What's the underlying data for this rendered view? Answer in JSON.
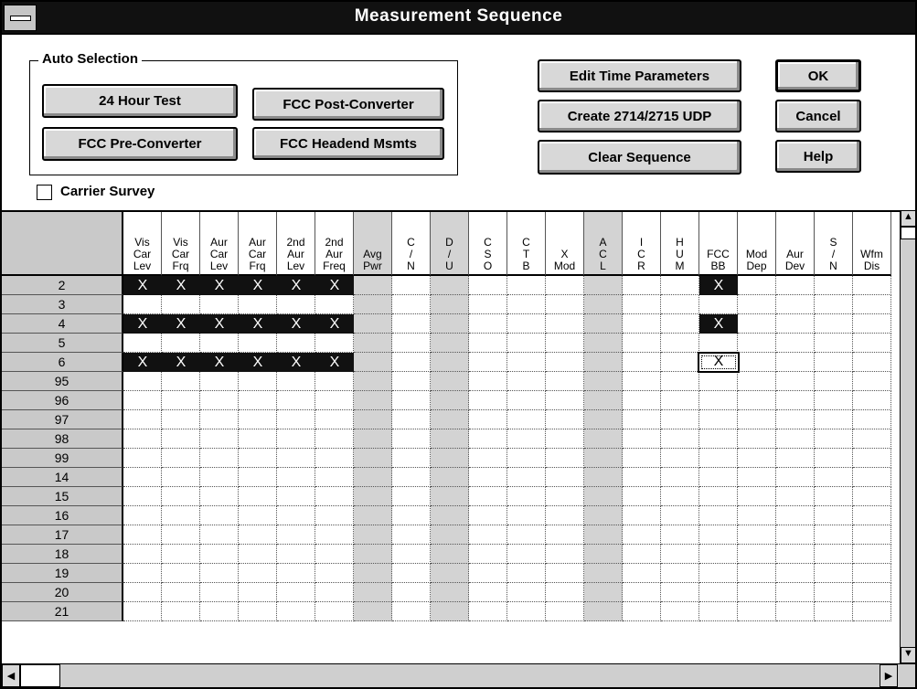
{
  "window": {
    "title": "Measurement Sequence"
  },
  "auto_selection": {
    "label": "Auto Selection",
    "buttons": [
      "24 Hour Test",
      "FCC Post-Converter",
      "FCC Pre-Converter",
      "FCC Headend Msmts"
    ]
  },
  "actions": {
    "edit_time": "Edit Time Parameters",
    "create_udp": "Create 2714/2715 UDP",
    "clear": "Clear Sequence",
    "ok": "OK",
    "cancel": "Cancel",
    "help": "Help"
  },
  "carrier_survey": {
    "label": "Carrier Survey",
    "checked": false
  },
  "columns": [
    {
      "label": "Vis\nCar\nLev",
      "shaded": false
    },
    {
      "label": "Vis\nCar\nFrq",
      "shaded": false
    },
    {
      "label": "Aur\nCar\nLev",
      "shaded": false
    },
    {
      "label": "Aur\nCar\nFrq",
      "shaded": false
    },
    {
      "label": "2nd\nAur\nLev",
      "shaded": false
    },
    {
      "label": "2nd\nAur\nFreq",
      "shaded": false
    },
    {
      "label": "Avg\nPwr",
      "shaded": true
    },
    {
      "label": "C\n/\nN",
      "shaded": false
    },
    {
      "label": "D\n/\nU",
      "shaded": true
    },
    {
      "label": "C\nS\nO",
      "shaded": false
    },
    {
      "label": "C\nT\nB",
      "shaded": false
    },
    {
      "label": "X\nMod",
      "shaded": false
    },
    {
      "label": "A\nC\nL",
      "shaded": true
    },
    {
      "label": "I\nC\nR",
      "shaded": false
    },
    {
      "label": "H\nU\nM",
      "shaded": false
    },
    {
      "label": "FCC\nBB",
      "shaded": false
    },
    {
      "label": "Mod\nDep",
      "shaded": false
    },
    {
      "label": "Aur\nDev",
      "shaded": false
    },
    {
      "label": "S\n/\nN",
      "shaded": false
    },
    {
      "label": "Wfm\nDis",
      "shaded": false
    }
  ],
  "rows": [
    "2",
    "3",
    "4",
    "5",
    "6",
    "95",
    "96",
    "97",
    "98",
    "99",
    "14",
    "15",
    "16",
    "17",
    "18",
    "19",
    "20",
    "21"
  ],
  "marks": [
    {
      "row": 0,
      "cols": [
        0,
        1,
        2,
        3,
        4,
        5,
        15
      ]
    },
    {
      "row": 2,
      "cols": [
        0,
        1,
        2,
        3,
        4,
        5,
        15
      ]
    },
    {
      "row": 4,
      "cols": [
        0,
        1,
        2,
        3,
        4,
        5
      ]
    }
  ],
  "selected_mark": {
    "row": 4,
    "col": 15
  },
  "mark_symbol": "X",
  "scroll": {
    "up": "▲",
    "down": "▼",
    "left": "◀",
    "right": "▶"
  }
}
